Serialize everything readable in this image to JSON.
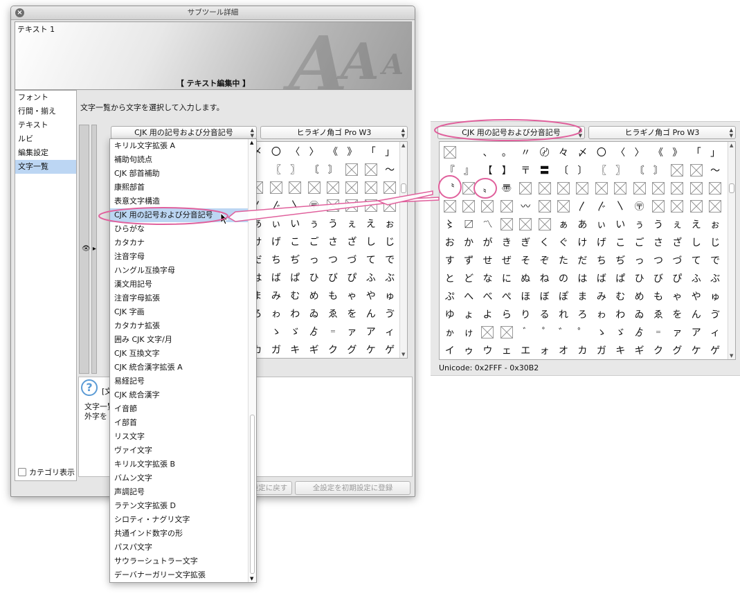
{
  "window": {
    "title": "サブツール詳細"
  },
  "banner": {
    "name": "テキスト 1",
    "status": "【 テキスト編集中 】",
    "letters": [
      "A",
      "A",
      "A"
    ]
  },
  "nav": {
    "items": [
      "フォント",
      "行間・揃え",
      "テキスト",
      "ルビ",
      "編集設定",
      "文字一覧"
    ],
    "selected_index": 5,
    "category_label": "カテゴリ表示"
  },
  "description": "文字一覧から文字を選択して入力します。",
  "category_select": {
    "value": "CJK 用の記号および分音記号"
  },
  "font_select": {
    "value": "ヒラギノ角ゴ Pro W3"
  },
  "dropdown": {
    "items": [
      "キリル文字拡張 A",
      "補助句読点",
      "CJK 部首補助",
      "康熙部首",
      "表意文字構造",
      "CJK 用の記号および分音記号",
      "ひらがな",
      "カタカナ",
      "注音字母",
      "ハングル互換字母",
      "漢文用記号",
      "注音字母拡張",
      "CJK 字画",
      "カタカナ拡張",
      "囲み CJK 文字/月",
      "CJK 互換文字",
      "CJK 統合漢字拡張 A",
      "易経記号",
      "CJK 統合漢字",
      "イ音節",
      "イ部首",
      "リス文字",
      "ヴァイ文字",
      "キリル文字拡張 B",
      "バムン文字",
      "声調記号",
      "ラテン文字拡張 D",
      "シロティ・ナグリ文字",
      "共通インド数字の形",
      "パスパ文字",
      "サウラーシュトラー文字",
      "デーバナーガリー文字拡張"
    ],
    "selected_index": 5
  },
  "char_grid": {
    "rows": [
      [
        "□",
        "",
        "、",
        "。",
        "〃",
        "〄",
        "々",
        "〆",
        "〇",
        "〈",
        "〉",
        "《",
        "》",
        "「",
        "」"
      ],
      [
        "『",
        "』",
        "【",
        "】",
        "〒",
        "〓",
        "〔",
        "〕",
        "〖",
        "〗",
        "〘",
        "〙",
        "□",
        "□",
        "〜"
      ],
      [
        "〝",
        "□",
        "〟",
        "〠",
        "□",
        "□",
        "□",
        "□",
        "□",
        "□",
        "□",
        "□",
        "□",
        "□",
        "□"
      ],
      [
        "□",
        "□",
        "□",
        "□",
        "〰",
        "□",
        "□",
        "〳",
        "〴",
        "〵",
        "〶",
        "□",
        "□",
        "□",
        "□"
      ],
      [
        "〻",
        "〼",
        "〽",
        "□",
        "□",
        "□",
        "ぁ",
        "あ",
        "ぃ",
        "い",
        "ぅ",
        "う",
        "ぇ",
        "え",
        "ぉ"
      ],
      [
        "お",
        "か",
        "が",
        "き",
        "ぎ",
        "く",
        "ぐ",
        "け",
        "げ",
        "こ",
        "ご",
        "さ",
        "ざ",
        "し",
        "じ"
      ],
      [
        "す",
        "ず",
        "せ",
        "ぜ",
        "そ",
        "ぞ",
        "た",
        "だ",
        "ち",
        "ぢ",
        "っ",
        "つ",
        "づ",
        "て",
        "で"
      ],
      [
        "と",
        "ど",
        "な",
        "に",
        "ぬ",
        "ね",
        "の",
        "は",
        "ば",
        "ぱ",
        "ひ",
        "び",
        "ぴ",
        "ふ",
        "ぶ"
      ],
      [
        "ぷ",
        "へ",
        "べ",
        "ぺ",
        "ほ",
        "ぼ",
        "ぽ",
        "ま",
        "み",
        "む",
        "め",
        "も",
        "ゃ",
        "や",
        "ゅ"
      ],
      [
        "ゆ",
        "ょ",
        "よ",
        "ら",
        "り",
        "る",
        "れ",
        "ろ",
        "ゎ",
        "わ",
        "ゐ",
        "ゑ",
        "を",
        "ん",
        "ゔ"
      ],
      [
        "ゕ",
        "ゖ",
        "□",
        "□",
        "゙",
        "゚",
        "゛",
        "゜",
        "ゝ",
        "ゞ",
        "ゟ",
        "゠",
        "ァ",
        "ア",
        "ィ"
      ],
      [
        "イ",
        "ゥ",
        "ウ",
        "ェ",
        "エ",
        "ォ",
        "オ",
        "カ",
        "ガ",
        "キ",
        "ギ",
        "ク",
        "グ",
        "ケ",
        "ゲ"
      ]
    ]
  },
  "help": {
    "title": "[文",
    "line1": "文字一覧",
    "line2": "外字を"
  },
  "buttons": {
    "reset": "設定に戻す",
    "register": "全設定を初期設定に登録"
  },
  "unicode_range": "Unicode: 0x2FFF - 0x30B2",
  "colors": {
    "highlight": "#e0609c",
    "selection": "#bcd6f3"
  }
}
